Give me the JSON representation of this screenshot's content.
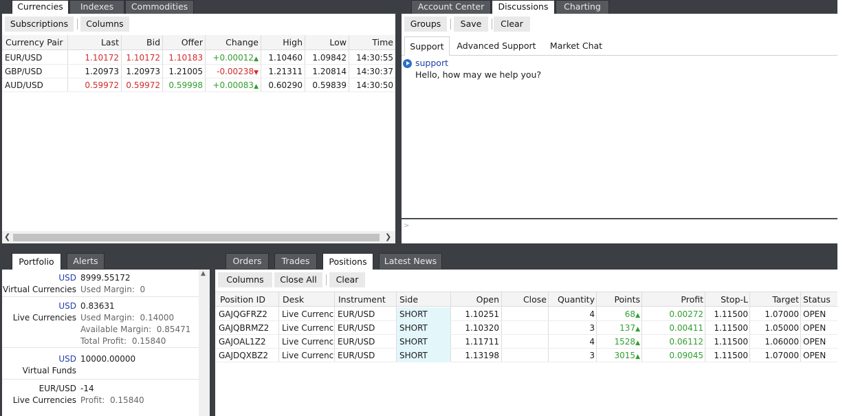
{
  "top_left": {
    "tabs": [
      "Currencies",
      "Indexes",
      "Commodities"
    ],
    "buttons": {
      "subscriptions": "Subscriptions",
      "columns": "Columns"
    },
    "headers": [
      "Currency Pair",
      "Last",
      "Bid",
      "Offer",
      "Change",
      "High",
      "Low",
      "Time"
    ],
    "rows": [
      {
        "pair": "EUR/USD",
        "last": "1.10172",
        "bid": "1.10172",
        "offer": "1.10183",
        "change": "+0.00012",
        "dir": "▲",
        "high": "1.10460",
        "low": "1.09842",
        "time": "14:30:55"
      },
      {
        "pair": "GBP/USD",
        "last": "1.20973",
        "bid": "1.20973",
        "offer": "1.21005",
        "change": "-0.00238",
        "dir": "▼",
        "high": "1.21311",
        "low": "1.20814",
        "time": "14:30:37"
      },
      {
        "pair": "AUD/USD",
        "last": "0.59972",
        "bid": "0.59972",
        "offer": "0.59998",
        "change": "+0.00083",
        "dir": "▲",
        "high": "0.60290",
        "low": "0.59839",
        "time": "14:30:50"
      }
    ]
  },
  "top_right": {
    "tabs": [
      "Account Center",
      "Discussions",
      "Charting"
    ],
    "buttons": {
      "groups": "Groups",
      "save": "Save",
      "clear": "Clear"
    },
    "subtabs": [
      "Support",
      "Advanced Support",
      "Market Chat"
    ],
    "message": {
      "sender": "support",
      "text": "Hello, how may we help you?"
    },
    "input_prompt": ">"
  },
  "portfolio": {
    "tabs": [
      "Portfolio",
      "Alerts"
    ],
    "entries": [
      {
        "currency": "USD",
        "value": "8999.55172",
        "label": "Virtual Currencies",
        "details": [
          "Used Margin:  0"
        ]
      },
      {
        "currency": "USD",
        "value": "0.83631",
        "label": "Live Currencies",
        "details": [
          "Used Margin:  0.14000",
          "Available Margin:  0.85471",
          "Total Profit:  0.15840"
        ]
      },
      {
        "currency": "USD",
        "value": "10000.00000",
        "label": "Virtual Funds",
        "details": []
      },
      {
        "currency": "EUR/USD",
        "value": "-14",
        "label": "Live Currencies",
        "details": [
          "Profit:  0.15840"
        ]
      }
    ]
  },
  "positions": {
    "tabs": [
      "Orders",
      "Trades",
      "Positions",
      "Latest News"
    ],
    "buttons": {
      "columns": "Columns",
      "close_all": "Close All",
      "clear": "Clear"
    },
    "headers": [
      "Position ID",
      "Desk",
      "Instrument",
      "Side",
      "Open",
      "Close",
      "Quantity",
      "Points",
      "Profit",
      "Stop-L",
      "Target",
      "Status"
    ],
    "rows": [
      {
        "id": "GAJQGFRZ2",
        "desk": "Live Currencies",
        "instrument": "EUR/USD",
        "side": "SHORT",
        "open": "1.10251",
        "close": "",
        "quantity": "4",
        "points": "68",
        "profit": "0.00272",
        "stop": "1.11500",
        "target": "1.07000",
        "status": "OPEN"
      },
      {
        "id": "GAJQBRMZ2",
        "desk": "Live Currencies",
        "instrument": "EUR/USD",
        "side": "SHORT",
        "open": "1.10320",
        "close": "",
        "quantity": "3",
        "points": "137",
        "profit": "0.00411",
        "stop": "1.11500",
        "target": "1.05000",
        "status": "OPEN"
      },
      {
        "id": "GAJOAL1Z2",
        "desk": "Live Currencies",
        "instrument": "EUR/USD",
        "side": "SHORT",
        "open": "1.11711",
        "close": "",
        "quantity": "4",
        "points": "1528",
        "profit": "0.06112",
        "stop": "1.11500",
        "target": "1.06000",
        "status": "OPEN"
      },
      {
        "id": "GAJDQXBZ2",
        "desk": "Live Currencies",
        "instrument": "EUR/USD",
        "side": "SHORT",
        "open": "1.13198",
        "close": "",
        "quantity": "3",
        "points": "3015",
        "profit": "0.09045",
        "stop": "1.11500",
        "target": "1.07000",
        "status": "OPEN"
      }
    ]
  },
  "colors": {
    "frame": "#3b3f44",
    "red": "#d42a2a",
    "green": "#2f9e2f",
    "blue": "#1f3ea8",
    "short_bg": "#e3f7fb"
  }
}
